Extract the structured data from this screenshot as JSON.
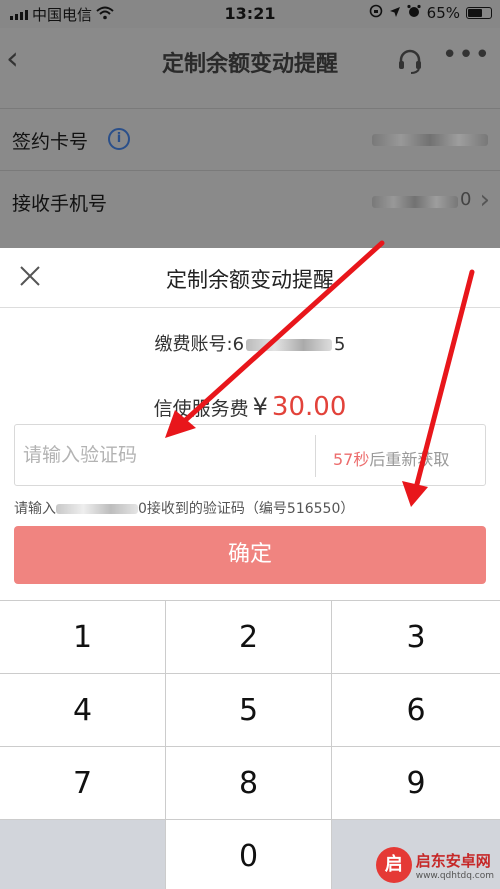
{
  "status_bar": {
    "carrier": "中国电信",
    "time": "13:21",
    "battery": "65%",
    "battery_level": 0.65
  },
  "background_page": {
    "title": "定制余额变动提醒",
    "rows": [
      {
        "label": "签约卡号"
      },
      {
        "label": "接收手机号",
        "visible_suffix": "0"
      }
    ]
  },
  "sheet": {
    "title": "定制余额变动提醒",
    "account_label": "缴费账号:",
    "account_prefix": "6",
    "account_suffix": "5",
    "fee_label": "信使服务费",
    "currency": "¥",
    "fee_amount": "30.00",
    "code_placeholder": "请输入验证码",
    "resend_seconds": "57秒",
    "resend_text": "后重新获取",
    "hint_prefix": "请输入",
    "hint_suffix": "0接收到的验证码（编号516550）",
    "confirm_label": "确定"
  },
  "keypad": {
    "keys": [
      "1",
      "2",
      "3",
      "4",
      "5",
      "6",
      "7",
      "8",
      "9",
      "",
      "0",
      ""
    ]
  },
  "colors": {
    "accent_red": "#e2423a",
    "confirm_bg": "#f08480",
    "countdown": "#ec6d6d",
    "arrow": "#e8161b"
  },
  "watermark": {
    "badge": "启",
    "name": "启东安卓网",
    "url": "www.qdhtdq.com"
  }
}
